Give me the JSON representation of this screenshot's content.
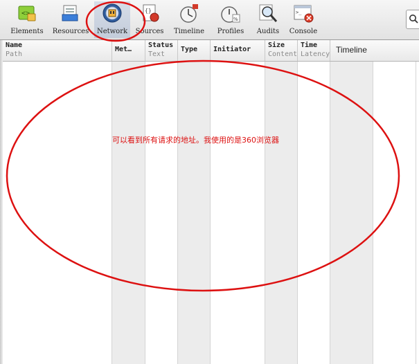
{
  "toolbar": {
    "items": [
      {
        "label": "Elements",
        "icon": "elements-icon"
      },
      {
        "label": "Resources",
        "icon": "resources-icon"
      },
      {
        "label": "Network",
        "icon": "network-icon",
        "selected": true
      },
      {
        "label": "Sources",
        "icon": "sources-icon"
      },
      {
        "label": "Timeline",
        "icon": "timeline-icon"
      },
      {
        "label": "Profiles",
        "icon": "profiles-icon"
      },
      {
        "label": "Audits",
        "icon": "audits-icon"
      },
      {
        "label": "Console",
        "icon": "console-icon"
      }
    ],
    "search_icon": "search-icon"
  },
  "grid": {
    "columns": [
      {
        "title": "Name",
        "subtitle": "Path"
      },
      {
        "title": "Met…",
        "subtitle": ""
      },
      {
        "title": "Status",
        "subtitle": "Text"
      },
      {
        "title": "Type",
        "subtitle": ""
      },
      {
        "title": "Initiator",
        "subtitle": ""
      },
      {
        "title": "Size",
        "subtitle": "Content"
      },
      {
        "title": "Time",
        "subtitle": "Latency"
      },
      {
        "title": "Timeline",
        "subtitle": ""
      }
    ]
  },
  "annotation": {
    "text": "可以看到所有请求的地址。我使用的是360浏览器",
    "color": "#dd1111"
  }
}
